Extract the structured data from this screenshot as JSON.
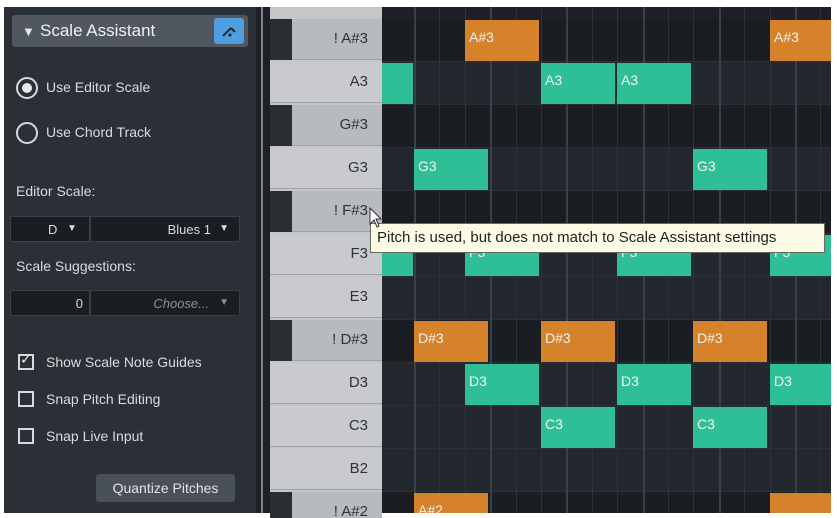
{
  "panel": {
    "title": "Scale Assistant",
    "collapse_icon": "triangle-down-icon",
    "header_button_icon": "pencil-scale-icon",
    "use_editor_scale": "Use Editor Scale",
    "use_chord_track": "Use Chord Track",
    "selected_source": "use_editor_scale",
    "editor_scale_label": "Editor Scale:",
    "editor_scale_root": "D",
    "editor_scale_type": "Blues 1",
    "scale_suggestions_label": "Scale Suggestions:",
    "suggestions_count": "0",
    "suggestions_placeholder": "Choose...",
    "show_guides": "Show Scale Note Guides",
    "show_guides_checked": true,
    "snap_pitch": "Snap Pitch Editing",
    "snap_pitch_checked": false,
    "snap_live": "Snap Live Input",
    "snap_live_checked": false,
    "quantize_button": "Quantize Pitches",
    "dropdown_arrow": "▼"
  },
  "keys": [
    {
      "label": "! A#3",
      "black": true
    },
    {
      "label": "A3",
      "black": false
    },
    {
      "label": "G#3",
      "black": true
    },
    {
      "label": "G3",
      "black": false
    },
    {
      "label": "! F#3",
      "black": true
    },
    {
      "label": "F3",
      "black": false
    },
    {
      "label": "E3",
      "black": false
    },
    {
      "label": "! D#3",
      "black": true
    },
    {
      "label": "D3",
      "black": false
    },
    {
      "label": "C3",
      "black": false
    },
    {
      "label": "B2",
      "black": false
    },
    {
      "label": "! A#2",
      "black": true
    }
  ],
  "notes": [
    {
      "row": 0,
      "beat": 3,
      "len": 3,
      "label": "A#3",
      "color": "orange"
    },
    {
      "row": 0,
      "beat": 15,
      "len": 3,
      "label": "A#3",
      "color": "orange"
    },
    {
      "row": 1,
      "beat": 0,
      "len": 1,
      "label": "",
      "color": "green"
    },
    {
      "row": 1,
      "beat": 6,
      "len": 3,
      "label": "A3",
      "color": "green"
    },
    {
      "row": 1,
      "beat": 9,
      "len": 3,
      "label": "A3",
      "color": "green"
    },
    {
      "row": 3,
      "beat": 1,
      "len": 3,
      "label": "G3",
      "color": "green"
    },
    {
      "row": 3,
      "beat": 12,
      "len": 3,
      "label": "G3",
      "color": "green"
    },
    {
      "row": 5,
      "beat": 0,
      "len": 1,
      "label": "",
      "color": "green"
    },
    {
      "row": 5,
      "beat": 3,
      "len": 3,
      "label": "F3",
      "color": "green"
    },
    {
      "row": 5,
      "beat": 9,
      "len": 3,
      "label": "F3",
      "color": "green"
    },
    {
      "row": 5,
      "beat": 15,
      "len": 3,
      "label": "F3",
      "color": "green"
    },
    {
      "row": 7,
      "beat": 1,
      "len": 3,
      "label": "D#3",
      "color": "orange"
    },
    {
      "row": 7,
      "beat": 6,
      "len": 3,
      "label": "D#3",
      "color": "orange"
    },
    {
      "row": 7,
      "beat": 12,
      "len": 3,
      "label": "D#3",
      "color": "orange"
    },
    {
      "row": 8,
      "beat": 3,
      "len": 3,
      "label": "D3",
      "color": "green"
    },
    {
      "row": 8,
      "beat": 9,
      "len": 3,
      "label": "D3",
      "color": "green"
    },
    {
      "row": 8,
      "beat": 15,
      "len": 3,
      "label": "D3",
      "color": "green"
    },
    {
      "row": 9,
      "beat": 6,
      "len": 3,
      "label": "C3",
      "color": "green"
    },
    {
      "row": 9,
      "beat": 12,
      "len": 3,
      "label": "C3",
      "color": "green"
    },
    {
      "row": 11,
      "beat": 1,
      "len": 3,
      "label": "A#2",
      "color": "orange"
    },
    {
      "row": 11,
      "beat": 15,
      "len": 3,
      "label": "",
      "color": "orange"
    }
  ],
  "tooltip": "Pitch is used, but does not match to Scale Assistant settings",
  "colors": {
    "note_green": "#2fbf96",
    "note_orange": "#d6822a",
    "accent": "#4f9fe0"
  }
}
